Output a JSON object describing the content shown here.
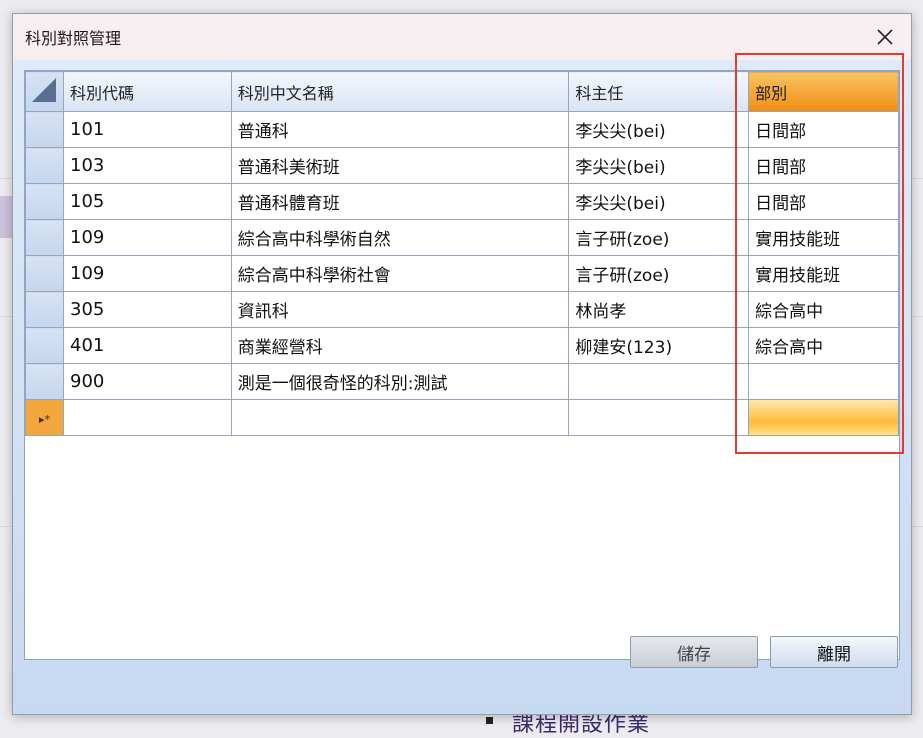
{
  "window": {
    "title": "科別對照管理"
  },
  "grid": {
    "columns": [
      "科別代碼",
      "科別中文名稱",
      "科主任",
      "部別"
    ],
    "rows": [
      {
        "code": "101",
        "name": "普通科",
        "head": "李尖尖(bei)",
        "dept": "日間部"
      },
      {
        "code": "103",
        "name": "普通科美術班",
        "head": "李尖尖(bei)",
        "dept": "日間部"
      },
      {
        "code": "105",
        "name": "普通科體育班",
        "head": "李尖尖(bei)",
        "dept": "日間部"
      },
      {
        "code": "109",
        "name": "綜合高中科學術自然",
        "head": "言子研(zoe)",
        "dept": "實用技能班"
      },
      {
        "code": "109",
        "name": "綜合高中科學術社會",
        "head": "言子研(zoe)",
        "dept": "實用技能班"
      },
      {
        "code": "305",
        "name": "資訊科",
        "head": "林尚孝",
        "dept": "綜合高中"
      },
      {
        "code": "401",
        "name": "商業經營科",
        "head": "柳建安(123)",
        "dept": "綜合高中"
      },
      {
        "code": "900",
        "name": "測是一個很奇怪的科別:測試",
        "head": "",
        "dept": ""
      }
    ],
    "new_row_marker": "▸*"
  },
  "buttons": {
    "save": "儲存",
    "leave": "離開"
  },
  "background": {
    "heading": "課程開設作業"
  },
  "colors": {
    "highlight": "#e23c31",
    "selected_column": "#f08d12"
  }
}
